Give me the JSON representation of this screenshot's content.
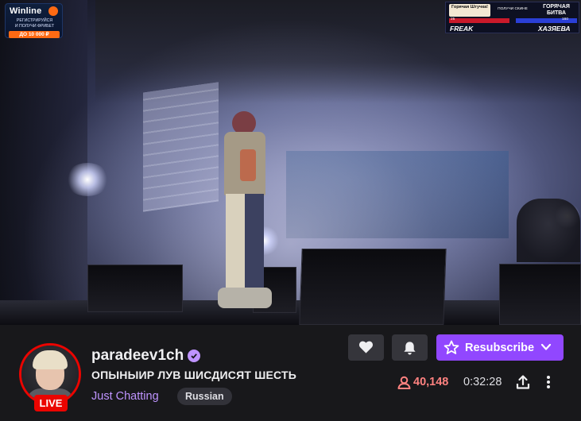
{
  "overlays": {
    "winline": {
      "logo": "Winline",
      "line1": "РЕГИСТРИРУЙСЯ",
      "line2": "И ПОЛУЧИ ФРИБЕТ",
      "amount": "ДО 10 000 ₽"
    },
    "hot_fight": {
      "badge": "Горячая Штучка!",
      "middle": "ПОЛУЧИ СКИНЕ",
      "right": "ГОРЯЧАЯ БИТВА",
      "left_score": "25",
      "right_score": "160",
      "left_name": "FREAK",
      "right_name": "ХАЗЯЕВА",
      "colors": {
        "left": "#c9192a",
        "right": "#2a3fd6"
      }
    }
  },
  "channel": {
    "name": "paradeev1ch",
    "verified": true,
    "live_badge": "LIVE",
    "title": "ОПЫНЫИР ЛУВ ШИСДИСЯТ ШЕСТЬ",
    "category": "Just Chatting",
    "tags": [
      "Russian"
    ]
  },
  "actions": {
    "follow_icon": "heart-icon",
    "notify_icon": "bell-icon",
    "resubscribe_label": "Resubscribe"
  },
  "stats": {
    "viewers": "40,148",
    "uptime": "0:32:28"
  },
  "colors": {
    "accent": "#9147ff",
    "live": "#eb0400",
    "viewer_count": "#ff8280",
    "category": "#bf94ff"
  }
}
